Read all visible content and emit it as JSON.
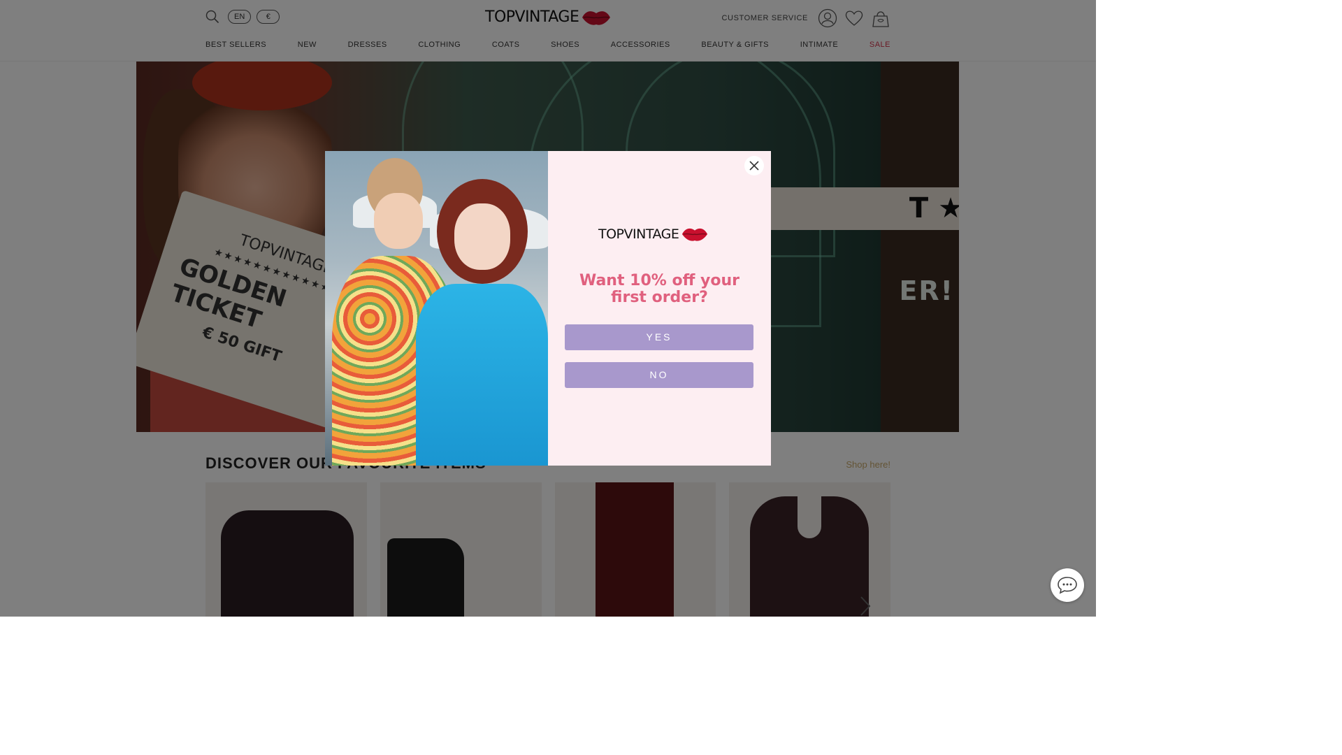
{
  "header": {
    "language": "EN",
    "currency": "€",
    "logo_text": "TOPVINTAGE",
    "customer_service": "CUSTOMER SERVICE"
  },
  "nav": {
    "items": [
      "BEST SELLERS",
      "NEW",
      "DRESSES",
      "CLOTHING",
      "COATS",
      "SHOES",
      "ACCESSORIES",
      "BEAUTY & GIFTS",
      "INTIMATE",
      "SALE"
    ],
    "sale_color": "#d2354d"
  },
  "hero": {
    "ticket_brand": "TOPVINTAGE",
    "ticket_stars": "★★★★★★★★★★★★★★★",
    "ticket_title": "GOLDEN TICKET",
    "ticket_gift": "€ 50 GIFT",
    "badge_text": "T ★",
    "big_text": "ER!"
  },
  "discover": {
    "title": "DISCOVER OUR FAVOURITE ITEMS",
    "shop_link": "Shop here!"
  },
  "popup": {
    "logo_text": "TOPVINTAGE",
    "question": "Want 10% off your first order?",
    "yes_label": "YES",
    "no_label": "NO",
    "accent_color": "#e0607e",
    "button_color": "#a898cc",
    "panel_color": "#fdeef2"
  },
  "icons": {
    "search": "search-icon",
    "account": "user-icon",
    "wishlist": "heart-icon",
    "bag": "shopping-bag-icon",
    "close": "close-icon",
    "chat": "chat-icon",
    "next": "chevron-right-icon",
    "lips": "lips-logo-icon"
  }
}
